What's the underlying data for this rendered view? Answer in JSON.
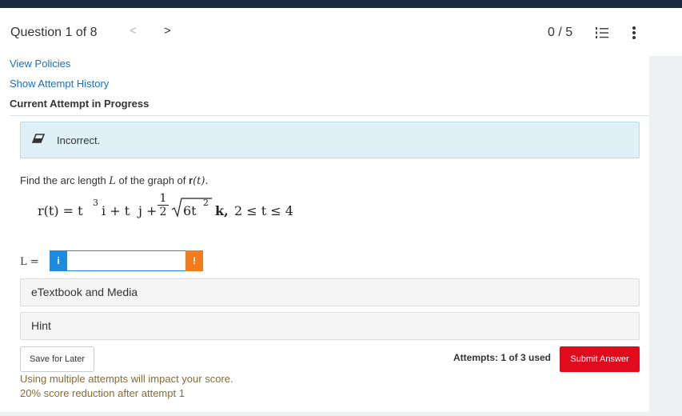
{
  "header": {
    "question_title": "Question 1 of 8",
    "prev_glyph": "<",
    "next_glyph": ">",
    "score": "0 / 5",
    "list_icon": "numbered-list-icon",
    "more_icon": "vertical-ellipsis-icon",
    "bar_color": "#1d2a44"
  },
  "links": {
    "view_policies": "View Policies",
    "attempt_history": "Show Attempt History"
  },
  "status": {
    "current_attempt": "Current Attempt in Progress",
    "feedback": "Incorrect.",
    "feedback_icon": "eraser-icon",
    "feedback_bg": "#dff0f7"
  },
  "question": {
    "prompt_pre": "Find the arc length ",
    "prompt_var": "L",
    "prompt_mid": " of the graph of ",
    "prompt_func": "r",
    "prompt_arg": "(t).",
    "eq_lhs": "r(t) = t",
    "eq_exp3": "3",
    "eq_i": "i + t",
    "eq_j": "j +",
    "eq_frac_num": "1",
    "eq_frac_den": "2",
    "eq_radicand": "6t",
    "eq_exp2": "2",
    "eq_k": "k,",
    "eq_range": "2 ≤ t ≤ 4"
  },
  "answer": {
    "label": "L =",
    "info_glyph": "i",
    "value": "",
    "warn_glyph": "!",
    "info_color": "#1b8ae0",
    "warn_color": "#f27b1c"
  },
  "resources": {
    "etextbook": "eTextbook and Media",
    "hint": "Hint"
  },
  "footer": {
    "save_label": "Save for Later",
    "attempts": "Attempts: 1 of 3 used",
    "submit_label": "Submit Answer",
    "submit_color": "#e00b1c",
    "note_1": "Using multiple attempts will impact your score.",
    "note_2": "20% score reduction after attempt 1"
  }
}
